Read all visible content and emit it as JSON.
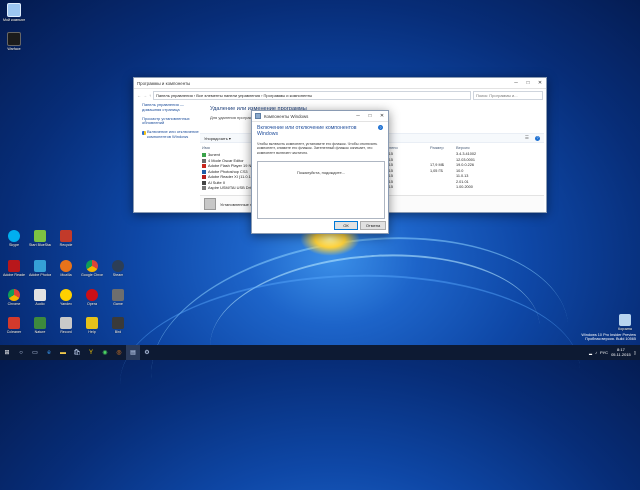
{
  "desktop": {
    "icons": [
      {
        "label": "Мой компьютер"
      },
      {
        "label": "Warface"
      },
      {
        "label": "Skype"
      },
      {
        "label": "Start BlueStacks"
      },
      {
        "label": "Recycle"
      },
      {
        "label": "Adobe Reader"
      },
      {
        "label": "Adobe Photoshop"
      },
      {
        "label": "Mozilla"
      },
      {
        "label": "Google Chrome"
      },
      {
        "label": "Steam"
      },
      {
        "label": "Chrome"
      },
      {
        "label": "Audio"
      },
      {
        "label": "Yandex"
      },
      {
        "label": "Opera"
      },
      {
        "label": "Game"
      },
      {
        "label": "Ccleaner"
      },
      {
        "label": "Nature"
      },
      {
        "label": "Record"
      },
      {
        "label": "Help"
      },
      {
        "label": "Bird"
      },
      {
        "label": "Корзина"
      }
    ],
    "watermark": {
      "line1": "Windows 10 Pro Insider Preview",
      "line2": "Пробная версия. Build 10565"
    }
  },
  "programs_window": {
    "title": "Программы и компоненты",
    "breadcrumb": "Панель управления  ›  Все элементы панели управления  ›  Программы и компоненты",
    "search_placeholder": "Поиск: Программы и...",
    "sidebar": {
      "home": "Панель управления — домашняя страница",
      "updates": "Просмотр установленных обновлений",
      "features": "Включение или отключение компонентов Windows"
    },
    "heading": "Удаление или изменение программы",
    "subheading": "Для удаления программ выберите ее в списке...",
    "organize": "Упорядочить ▾",
    "columns": {
      "name": "Имя",
      "installed": "Установлено",
      "size": "Размер",
      "version": "Версия"
    },
    "rows": [
      {
        "name": "3unent",
        "date": "22.10.2015",
        "size": "",
        "version": "3.4.3.41002",
        "color": "#3aa34a"
      },
      {
        "name": "4 Mode Oscar Editor",
        "date": "18.10.2015",
        "size": "",
        "version": "12.03.0001",
        "color": "#6a6a6a"
      },
      {
        "name": "Adobe Flash Player 19 NPAPI",
        "date": "22.10.2015",
        "size": "17,9 МБ",
        "version": "19.0.0.226",
        "color": "#c8261b"
      },
      {
        "name": "Adobe Photoshop CS3",
        "date": "17.10.2015",
        "size": "1,05 ГБ",
        "version": "10.0",
        "color": "#1e5ea8"
      },
      {
        "name": "Adobe Reader XI (11.0.13)",
        "date": "19.10.2015",
        "size": "",
        "version": "11.0.13",
        "color": "#b31e1e"
      },
      {
        "name": "AI Suite II",
        "date": "18.10.2015",
        "size": "",
        "version": "2.01.01",
        "color": "#444"
      },
      {
        "name": "Aspire USM/TAI USB Driv...",
        "date": "18.10.2015",
        "size": "",
        "version": "1.00.2000",
        "color": "#777"
      }
    ],
    "status": "Установленные программы"
  },
  "features_dialog": {
    "title": "Компоненты Windows",
    "heading": "Включение или отключение компонентов Windows",
    "description": "Чтобы включить компонент, установите его флажок. Чтобы отключить компонент, снимите его флажок. Затененный флажок означает, что компонент включен частично.",
    "loading": "Пожалуйста, подождите...",
    "ok": "ОК",
    "cancel": "Отмена"
  },
  "taskbar": {
    "lang": "РУС",
    "time": "8:17",
    "date": "05.11.2015"
  }
}
